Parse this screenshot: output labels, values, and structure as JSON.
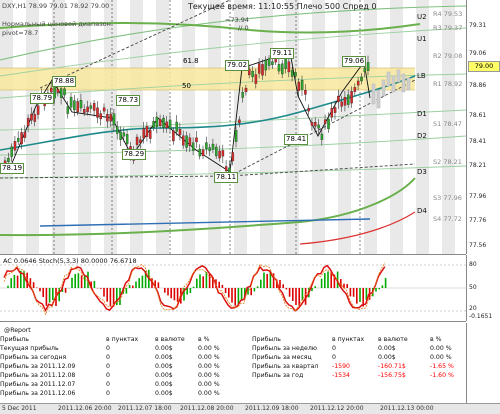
{
  "window": {
    "symbol_line": "DXY,H1  78.99 79.01 78.92 79.00"
  },
  "header": {
    "time_label": "Текущее время: 11:10:55",
    "leverage_label": "Плечо 500",
    "spread_label": "Спред 0",
    "ind_name": "Нормальный ценовой диапазон",
    "pivot_label": "pivot=78.7",
    "equity_label": "=73.94",
    "bars_label": "// 0"
  },
  "fib_labels": {
    "f618": "61.8",
    "f50": "50"
  },
  "price_tags": [
    "78.88",
    "78.79",
    "78.73",
    "78.29",
    "78.11",
    "79.02",
    "79.11",
    "78.41",
    "79.06",
    "78.19"
  ],
  "levels": {
    "U2": "U2",
    "U1": "U1",
    "LB": "LB",
    "D1": "D1",
    "D2": "D2",
    "D3": "D3",
    "D4": "D4"
  },
  "price_axis": [
    "79.31",
    "79.06",
    "78.86",
    "78.61",
    "78.41",
    "78.21",
    "77.96",
    "77.76",
    "77.56"
  ],
  "price_axis_right_labels": [
    "R4 79.53",
    "R3 79.37",
    "R2 79.08",
    "R1 78.92",
    "S1 78.47",
    "S2 78.21",
    "S3 77.96",
    "S4 77.72"
  ],
  "current_price": "79.00",
  "oscillators": {
    "ac_label": "AC 0.0646",
    "stoch_label": "Stoch(5,3,3) 80.0000 76.6718",
    "axis": [
      "80",
      "50",
      "20",
      "-0.1651"
    ],
    "ac_colors": {
      "up": "#00aa00",
      "down": "#dd0000"
    }
  },
  "report": {
    "title": "@Report",
    "headers_left": [
      "Прибыль",
      "в пунктах",
      "в валюте",
      "в %"
    ],
    "rows_left": [
      [
        "Текущая прибыль",
        "0",
        "0.00$",
        "0.00 %"
      ],
      [
        "Прибыль за сегодня",
        "0",
        "0.00$",
        "0.00 %"
      ],
      [
        "Прибыль за 2011.12.09",
        "0",
        "0.00$",
        "0.00 %"
      ],
      [
        "Прибыль за 2011.12.08",
        "0",
        "0.00$",
        "0.00 %"
      ],
      [
        "Прибыль за 2011.12.07",
        "0",
        "0.00$",
        "0.00 %"
      ],
      [
        "Прибыль за 2011.12.06",
        "0",
        "0.00$",
        "0.00 %"
      ]
    ],
    "headers_right": [
      "Прибыль",
      "в пунктах",
      "в валюте",
      "в %"
    ],
    "rows_right": [
      [
        "Прибыль за неделю",
        "0",
        "0.00$",
        "0.00 %"
      ],
      [
        "Прибыль за месяц",
        "0",
        "0.00$",
        "0.00 %"
      ],
      [
        "Прибыль за квартал",
        "-1590",
        "-160.71$",
        "-1.65 %"
      ],
      [
        "Прибыль за год",
        "-1534",
        "-156.75$",
        "-1.60 %"
      ]
    ],
    "negative_color": "#ff0000"
  },
  "time_axis": [
    "5 Dec 2011",
    "2011.12.06 20:00",
    "2011.12.07 18:00",
    "2011.12.08 20:00",
    "2011.12.09 18:00",
    "2011.12.12 20:00",
    "2011.12.13 00:00"
  ]
}
